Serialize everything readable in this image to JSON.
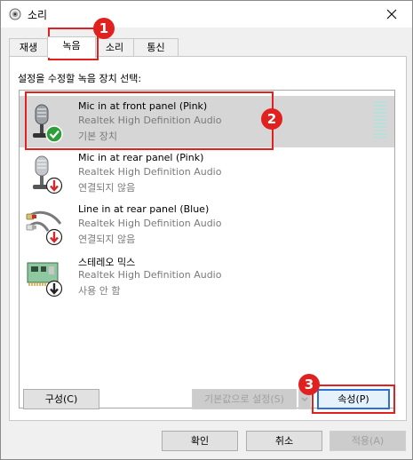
{
  "window": {
    "title": "소리",
    "close_glyph": "✕"
  },
  "tabs": [
    {
      "label": "재생"
    },
    {
      "label": "녹음",
      "selected": true
    },
    {
      "label": "소리"
    },
    {
      "label": "통신"
    }
  ],
  "instruction": "설정을 수정할 녹음 장치 선택:",
  "devices": [
    {
      "name": "Mic in at front panel (Pink)",
      "driver": "Realtek High Definition Audio",
      "status": "기본 장치",
      "icon": "microphone-icon",
      "badge_icon": "default-check-icon",
      "selected": true
    },
    {
      "name": "Mic in at rear panel (Pink)",
      "driver": "Realtek High Definition Audio",
      "status": "연결되지 않음",
      "icon": "microphone-icon",
      "badge_icon": "unplugged-arrow-icon"
    },
    {
      "name": "Line in at rear panel (Blue)",
      "driver": "Realtek High Definition Audio",
      "status": "연결되지 않음",
      "icon": "audio-cable-icon",
      "badge_icon": "unplugged-arrow-icon"
    },
    {
      "name": "스테레오 믹스",
      "driver": "Realtek High Definition Audio",
      "status": "사용 안 함",
      "icon": "sound-card-icon",
      "badge_icon": "disabled-arrow-icon"
    }
  ],
  "buttons": {
    "configure": "구성(C)",
    "set_default": "기본값으로 설정(S)",
    "properties": "속성(P)",
    "ok": "확인",
    "cancel": "취소",
    "apply": "적용(A)"
  },
  "annotations": [
    "1",
    "2",
    "3"
  ],
  "colors": {
    "annotation_red": "#e0211f",
    "selected_row": "#d6d6d6",
    "focus_blue": "#2f6fd6",
    "check_green": "#2e9e3a",
    "arrow_red": "#d9262a"
  }
}
